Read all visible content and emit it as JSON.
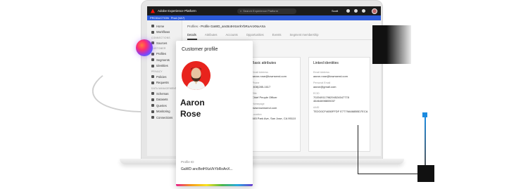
{
  "app": {
    "title": "Adobe Experience Platform",
    "search_placeholder": "Search Experience Platform",
    "org": "Scott"
  },
  "envbar": {
    "env": "PRODUCTION",
    "sandbox": "Prod (VA7)"
  },
  "sidebar": {
    "items": [
      {
        "label": "Home",
        "icon": "home-icon"
      },
      {
        "label": "Workflows",
        "icon": "workflow-icon"
      }
    ],
    "section_connections": "CONNECTIONS",
    "conn_items": [
      {
        "label": "Sources",
        "icon": "source-icon"
      }
    ],
    "section_customer": "CUSTOMER",
    "customer_items": [
      {
        "label": "Profiles",
        "icon": "profile-icon"
      },
      {
        "label": "Segments",
        "icon": "segment-icon"
      },
      {
        "label": "Identities",
        "icon": "identity-icon"
      }
    ],
    "section_privacy": "PRIVACY",
    "privacy_items": [
      {
        "label": "Policies",
        "icon": "policy-icon"
      },
      {
        "label": "Requests",
        "icon": "request-icon"
      }
    ],
    "section_data": "DATA MANAGEMENT",
    "data_items": [
      {
        "label": "Schemas",
        "icon": "schema-icon"
      },
      {
        "label": "Datasets",
        "icon": "dataset-icon"
      },
      {
        "label": "Queries",
        "icon": "query-icon"
      },
      {
        "label": "Monitoring",
        "icon": "monitor-icon"
      },
      {
        "label": "Connections",
        "icon": "connection-icon"
      }
    ]
  },
  "main": {
    "breadcrumb_root": "Profiles",
    "breadcrumb_current": "Profile GaWD_ancBotHXaVkYbRoAnXNxAXa",
    "tabs": [
      "Details",
      "Attributes",
      "Accounts",
      "Opportunities",
      "Events",
      "Segment membership"
    ]
  },
  "basic_attributes": {
    "title": "Basic attributes",
    "fields": [
      {
        "label": "Email Address",
        "value": "aaron.rose@townsend.com"
      },
      {
        "label": "Phone",
        "value": "(408)285-1617"
      },
      {
        "label": "Title",
        "value": "Chief People Officer"
      },
      {
        "label": "Homepage",
        "value": "www.townsend.com"
      },
      {
        "label": "Location",
        "value": "345 Park Ave, San Jose, CA 95110"
      }
    ]
  },
  "linked_identities": {
    "title": "Linked identities",
    "fields": [
      {
        "label": "Email Address",
        "value": "aaron.rose@townsend.com"
      },
      {
        "label": "Personal Email",
        "value": "aaron@gmail.com"
      },
      {
        "label": "ECID",
        "value": "70204911796294524547778 46464698805037"
      },
      {
        "label": "AAID",
        "value": "TE2G0CF4650FFDF E7779A6685BD7ECA"
      }
    ]
  },
  "profile_card": {
    "title": "Customer profile",
    "first_name": "Aaron",
    "last_name": "Rose",
    "id_label": "Profile ID",
    "id_value": "GaWD ancBotHXaVkYbRoAnX..."
  }
}
